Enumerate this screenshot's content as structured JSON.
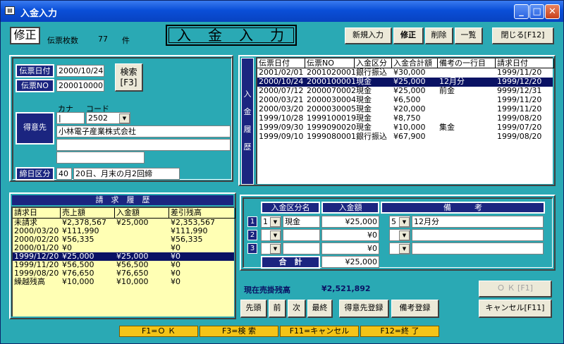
{
  "window": {
    "title": "入金入力",
    "icon": "form-icon"
  },
  "mode_label": "修正",
  "slip_count": {
    "label": "伝票枚数",
    "value": "77",
    "unit": "件"
  },
  "form_title": "入　金　入　力",
  "toolbar": {
    "new_entry": "新規入力",
    "edit": "修正",
    "delete": "削除",
    "list": "一覧",
    "close": "閉じる[F12]"
  },
  "slip": {
    "date_label": "伝票日付",
    "date_value": "2000/10/24",
    "no_label": "伝票NO",
    "no_value": "2000100001",
    "search_button_line1": "検索",
    "search_button_line2": "[F3]"
  },
  "customer": {
    "label": "得意先",
    "kana_label": "カナ",
    "code_label": "コード",
    "kana_value": "|",
    "code_value": "2502",
    "name": "小林電子産業株式会社",
    "address1": "",
    "address2": ""
  },
  "closing": {
    "label": "締日区分",
    "code": "40",
    "text": "20日、月末の月2回締"
  },
  "payment_history": {
    "side_label": "入金履歴",
    "headers": [
      "伝票日付",
      "伝票NO",
      "入金区分",
      "入金合計額",
      "備考の一行目",
      "請求日付"
    ],
    "rows": [
      [
        "2001/02/01",
        "2001020001",
        "銀行振込",
        "¥30,000",
        "",
        "1999/11/20"
      ],
      [
        "2000/10/24",
        "2000100001",
        "現金",
        "¥25,000",
        "12月分",
        "1999/12/20"
      ],
      [
        "2000/07/12",
        "2000070002",
        "現金",
        "¥25,000",
        "前金",
        "9999/12/31"
      ],
      [
        "2000/03/21",
        "2000030004",
        "現金",
        "¥6,500",
        "",
        "1999/11/20"
      ],
      [
        "2000/03/20",
        "2000030005",
        "現金",
        "¥20,000",
        "",
        "1999/11/20"
      ],
      [
        "1999/10/28",
        "1999100019",
        "現金",
        "¥8,750",
        "",
        "1999/08/20"
      ],
      [
        "1999/09/30",
        "1999090020",
        "現金",
        "¥10,000",
        "集金",
        "1999/07/20"
      ],
      [
        "1999/09/10",
        "1999080001",
        "銀行振込",
        "¥67,900",
        "",
        "1999/08/20"
      ]
    ],
    "selected_index": 1
  },
  "billing_history": {
    "title": "請　求　履　歴",
    "headers": [
      "請求日",
      "売上額",
      "入金額",
      "差引残高"
    ],
    "rows": [
      [
        "未請求",
        "¥2,378,567",
        "¥25,000",
        "¥2,353,567"
      ],
      [
        "2000/03/20",
        "¥111,990",
        "",
        "¥111,990"
      ],
      [
        "2000/02/20",
        "¥56,335",
        "",
        "¥56,335"
      ],
      [
        "2000/01/20",
        "¥0",
        "",
        "¥0"
      ],
      [
        "1999/12/20",
        "¥25,000",
        "¥25,000",
        "¥0"
      ],
      [
        "1999/11/20",
        "¥56,500",
        "¥56,500",
        "¥0"
      ],
      [
        "1999/08/20",
        "¥76,650",
        "¥76,650",
        "¥0"
      ],
      [
        "繰越残高",
        "¥10,000",
        "¥10,000",
        "¥0"
      ]
    ],
    "selected_index": 4
  },
  "entry": {
    "headers": {
      "type_name": "入金区分名",
      "amount": "入金額",
      "note": "備　　　考"
    },
    "rows": [
      {
        "num": "1",
        "type_code": "1",
        "type_name": "現金",
        "amount": "¥25,000",
        "note_code": "5",
        "note": "12月分"
      },
      {
        "num": "2",
        "type_code": "",
        "type_name": "",
        "amount": "¥0",
        "note_code": "",
        "note": ""
      },
      {
        "num": "3",
        "type_code": "",
        "type_name": "",
        "amount": "¥0",
        "note_code": "",
        "note": ""
      }
    ],
    "total_label": "合　計",
    "total_value": "¥25,000"
  },
  "balance": {
    "label": "現在売掛残高",
    "value": "¥2,521,892"
  },
  "nav": {
    "first": "先頭",
    "prev": "前",
    "next": "次",
    "last": "最終",
    "customer_reg": "得意先登録",
    "note_reg": "備考登録"
  },
  "actions": {
    "ok": "Ｏ Ｋ [F1]",
    "cancel": "キャンセル[F11]"
  },
  "statusbar": [
    "F1=Ｏ Ｋ",
    "F3=検 索",
    "F11=キャンセル",
    "F12=終 了"
  ]
}
